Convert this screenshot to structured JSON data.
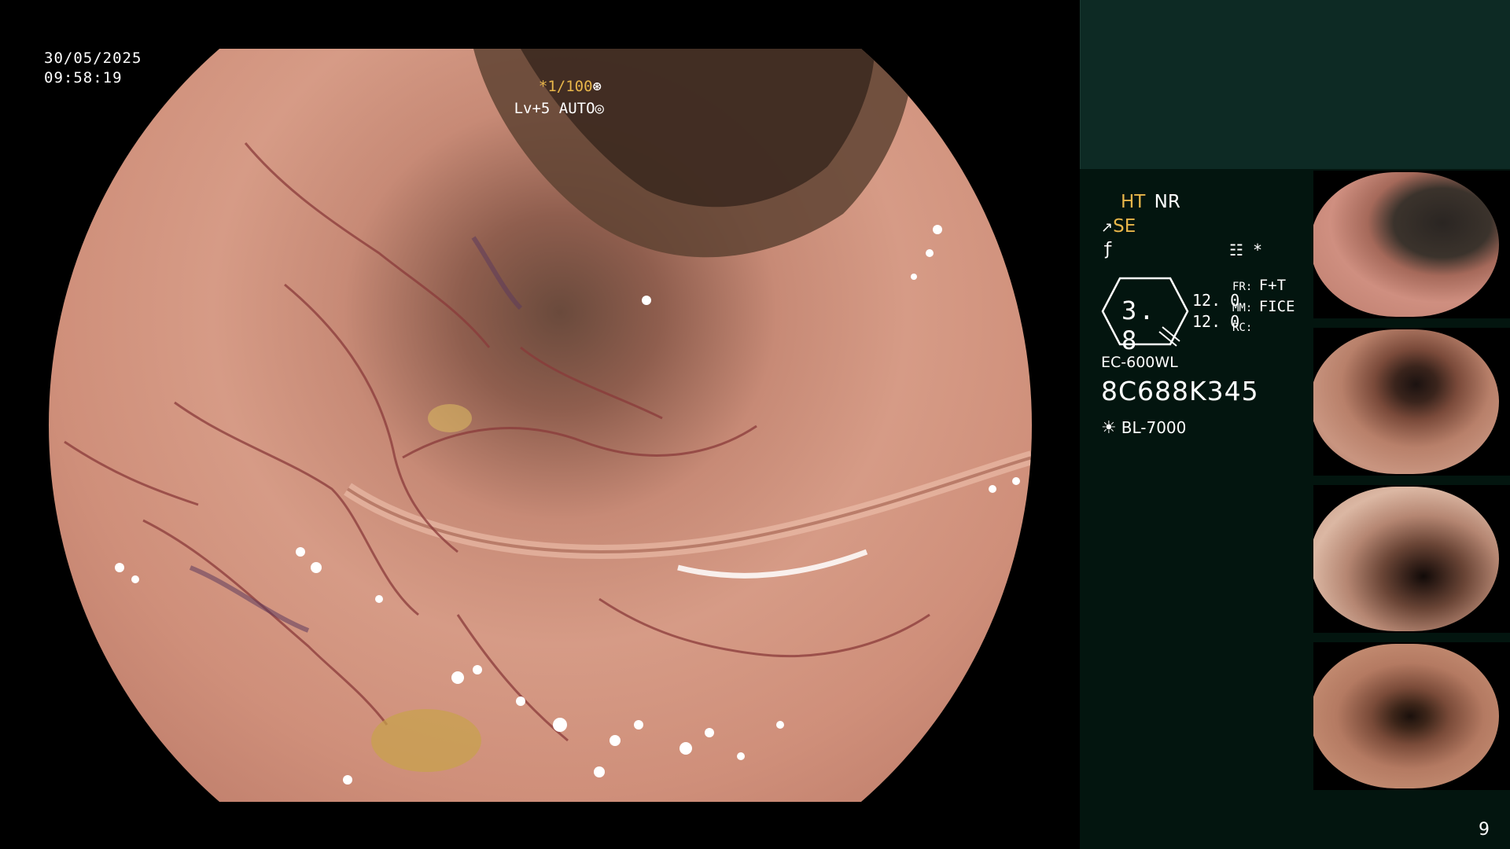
{
  "overlay": {
    "date": "30/05/2025",
    "time": "09:58:19",
    "shutter": "*1/100",
    "shutter_icon": "aperture-icon",
    "level": "Lv+5 AUTO",
    "level_icon": "iris-icon"
  },
  "side_panel": {
    "mode_ht": "HT",
    "mode_nr": "NR",
    "mode_se": "SE",
    "enhance_icon": "structure-enhance-icon",
    "f_icon": "f-mark-icon",
    "aux_icon": "memory-icon",
    "aux_star": "*",
    "zoom_value": "3. 8",
    "num_top": "12. 0",
    "num_bottom": "12. 0",
    "label_fr": "FR:",
    "value_fr": "F+T",
    "label_mm": "MM:",
    "value_mm": "FICE",
    "label_rc": "RC:",
    "scope_model": "EC-600WL",
    "scope_serial": "8C688K345",
    "light_icon": "light-source-icon",
    "light_source": "BL-7000",
    "page_number": "9"
  },
  "thumbnails": [
    "thumbnail-1",
    "thumbnail-2",
    "thumbnail-3",
    "thumbnail-4"
  ],
  "colors": {
    "accent": "#e8b64a",
    "panel_bg": "#03150f",
    "panel_top": "#0d2a24"
  }
}
